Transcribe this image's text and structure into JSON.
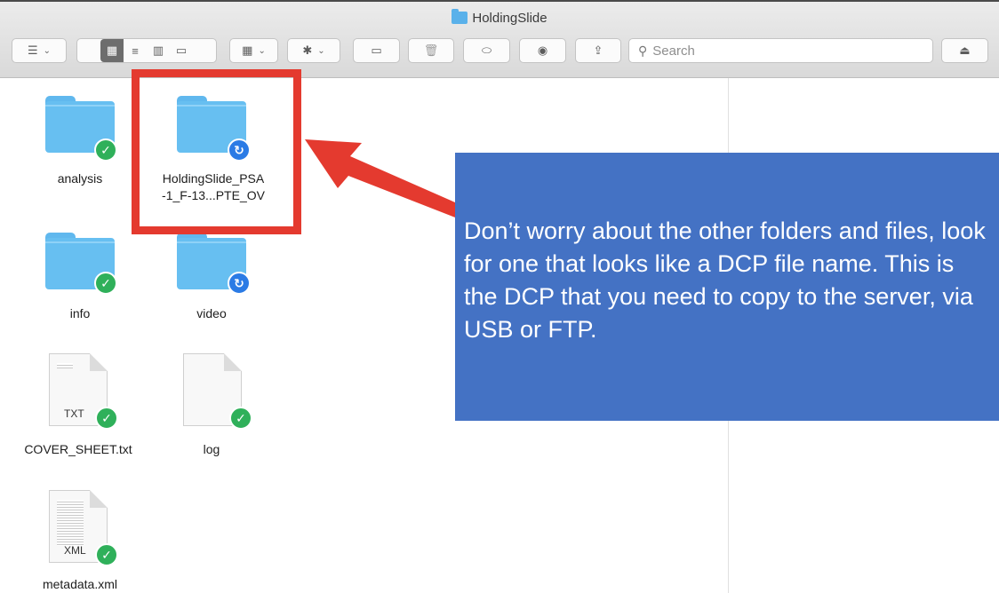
{
  "window": {
    "title": "HoldingSlide"
  },
  "toolbar": {
    "search_placeholder": "Search",
    "list_glyph": "☰",
    "view_icons": [
      "▦",
      "≡",
      "▥",
      "▭"
    ],
    "group_glyph": "▦",
    "gear_glyph": "✱",
    "chevron": "⌄",
    "new_folder_glyph": "▭",
    "trash_glyph": "🗑",
    "tag_glyph": "⬭",
    "eye_glyph": "◉",
    "share_glyph": "⇪",
    "eject_glyph": "⏏",
    "search_glyph": "⚲"
  },
  "files": [
    {
      "name": "analysis",
      "kind": "folder",
      "status": "synced"
    },
    {
      "name": "HoldingSlide_PSA\n-1_F-13...PTE_OV",
      "kind": "folder",
      "status": "syncing"
    },
    {
      "name": "info",
      "kind": "folder",
      "status": "synced"
    },
    {
      "name": "video",
      "kind": "folder",
      "status": "syncing"
    },
    {
      "name": "COVER_SHEET.txt",
      "kind": "document",
      "ext": "TXT",
      "status": "synced"
    },
    {
      "name": "log",
      "kind": "document",
      "ext": "",
      "status": "synced"
    },
    {
      "name": "metadata.xml",
      "kind": "document",
      "ext": "XML",
      "status": "synced"
    }
  ],
  "badges": {
    "synced": "✓",
    "syncing": "↻"
  },
  "annotation": {
    "text": "Don’t worry about the other folders and files, look for one that looks like a DCP file name. This is the DCP that you need to copy to the server, via USB or FTP.",
    "box_color": "#4472c4",
    "highlight_color": "#e43a2f"
  }
}
